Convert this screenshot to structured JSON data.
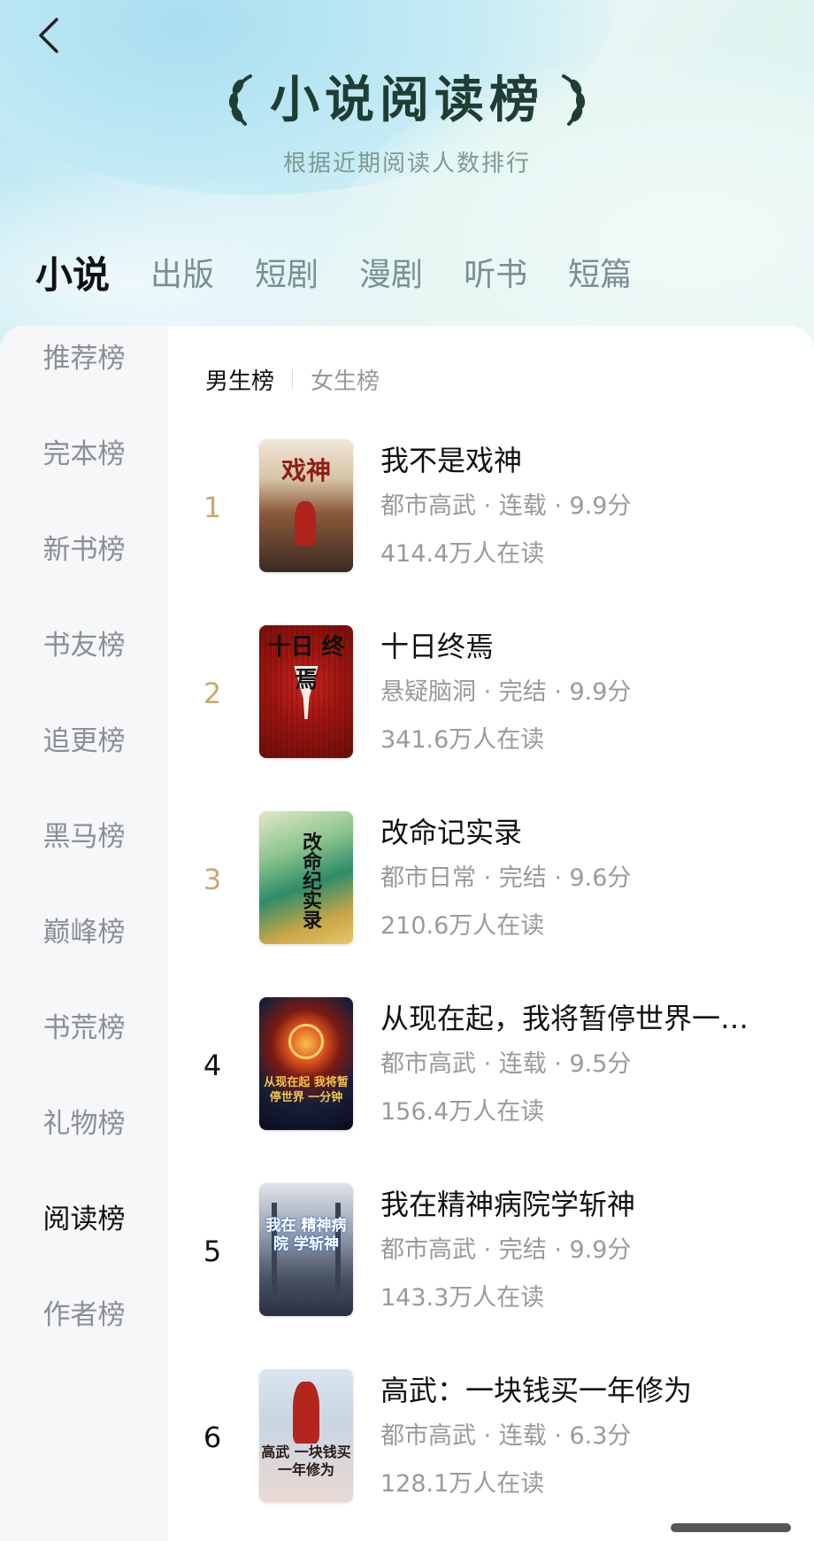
{
  "header": {
    "title": "小说阅读榜",
    "subtitle": "根据近期阅读人数排行"
  },
  "top_tabs": [
    "小说",
    "出版",
    "短剧",
    "漫剧",
    "听书",
    "短篇"
  ],
  "sidebar": [
    "推荐榜",
    "完本榜",
    "新书榜",
    "书友榜",
    "追更榜",
    "黑马榜",
    "巅峰榜",
    "书荒榜",
    "礼物榜",
    "阅读榜",
    "作者榜"
  ],
  "gender_tabs": [
    "男生榜",
    "女生榜"
  ],
  "books": [
    {
      "rank": "1",
      "title": "我不是戏神",
      "meta": "都市高武 · 连载 · 9.9分",
      "readers": "414.4万人在读",
      "cover_text": "戏神"
    },
    {
      "rank": "2",
      "title": "十日终焉",
      "meta": "悬疑脑洞 · 完结 · 9.9分",
      "readers": "341.6万人在读",
      "cover_text": "十日 终焉"
    },
    {
      "rank": "3",
      "title": "改命记实录",
      "meta": "都市日常 · 完结 · 9.6分",
      "readers": "210.6万人在读",
      "cover_text": "改命纪实录"
    },
    {
      "rank": "4",
      "title": "从现在起，我将暂停世界一…",
      "meta": "都市高武 · 连载 · 9.5分",
      "readers": "156.4万人在读",
      "cover_text": "从现在起 我将暂停世界 一分钟"
    },
    {
      "rank": "5",
      "title": "我在精神病院学斩神",
      "meta": "都市高武 · 完结 · 9.9分",
      "readers": "143.3万人在读",
      "cover_text": "我在 精神病院 学斩神"
    },
    {
      "rank": "6",
      "title": "高武：一块钱买一年修为",
      "meta": "都市高武 · 连载 · 6.3分",
      "readers": "128.1万人在读",
      "cover_text": "高武 一块钱买 一年修为"
    }
  ],
  "colors": {
    "rank_top3": "#c8a873",
    "active_text": "#111111",
    "muted_text": "#9a9a9a",
    "title_green": "#1f3d33"
  },
  "icons": {
    "back": "chevron-left-icon",
    "laurel": "laurel-icon"
  }
}
